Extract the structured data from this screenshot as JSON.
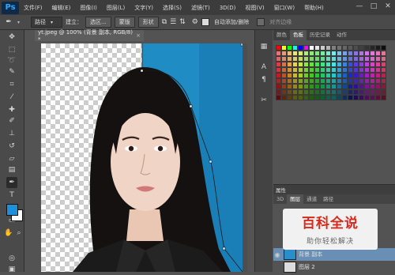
{
  "app": {
    "logo": "Ps"
  },
  "menu": [
    "文件(F)",
    "编辑(E)",
    "图像(I)",
    "图层(L)",
    "文字(Y)",
    "选择(S)",
    "滤镜(T)",
    "3D(D)",
    "视图(V)",
    "窗口(W)",
    "帮助(H)"
  ],
  "window_controls": {
    "minimize": "—",
    "maximize": "□",
    "close": "✕"
  },
  "options": {
    "mode_value": "路径",
    "build_label": "建立：",
    "selection_btn": "选区...",
    "mask_btn": "蒙版",
    "shape_btn": "形状",
    "auto_add_delete": "自动添加/删除",
    "align_edges": "对齐边缘"
  },
  "document": {
    "tab_title": "yt.jpeg @ 100% (背景 副本, RGB/8) *",
    "close": "×"
  },
  "panels": {
    "swatch_tabs": [
      "颜色",
      "色板",
      "历史记录",
      "动作"
    ],
    "active_swatch_tab": 1,
    "properties_title": "属性",
    "layer_tabs": [
      "3D",
      "图层",
      "通道",
      "路径"
    ],
    "active_layer_tab": 1,
    "layers": [
      {
        "name": "背景 副本",
        "visible": true
      },
      {
        "name": "图层 2",
        "visible": false
      }
    ]
  },
  "tools": [
    "move-tool",
    "marquee-tool",
    "lasso-tool",
    "quick-select-tool",
    "crop-tool",
    "eyedropper-tool",
    "healing-tool",
    "brush-tool",
    "stamp-tool",
    "history-brush-tool",
    "eraser-tool",
    "gradient-tool",
    "blur-tool",
    "dodge-tool",
    "pen-tool",
    "type-tool",
    "path-select-tool",
    "shape-tool",
    "hand-tool",
    "zoom-tool"
  ],
  "colors": {
    "foreground": "#1e8fd9",
    "background": "#ffffff",
    "photo_bg": "#1f8cc4"
  },
  "watermark": {
    "title": "百科全说",
    "subtitle": "助你轻松解决"
  }
}
